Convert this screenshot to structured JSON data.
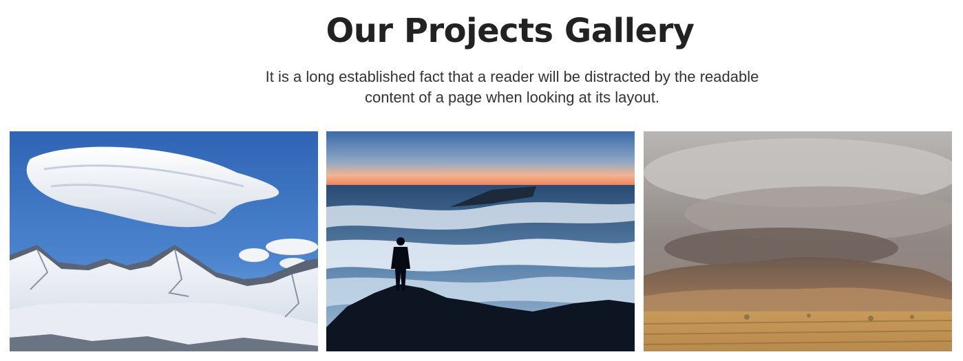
{
  "header": {
    "title": "Our Projects Gallery",
    "subtitle": "It is a long established fact that a reader will be distracted by the readable content of a page when looking at its layout."
  },
  "gallery": {
    "items": [
      {
        "image": "snowy-mountains-lenticular-cloud"
      },
      {
        "image": "hiker-above-sea-of-clouds"
      },
      {
        "image": "dust-storm-over-desert"
      }
    ]
  },
  "colors": {
    "title": "#222222",
    "subtitle": "#333333",
    "background": "#ffffff"
  }
}
